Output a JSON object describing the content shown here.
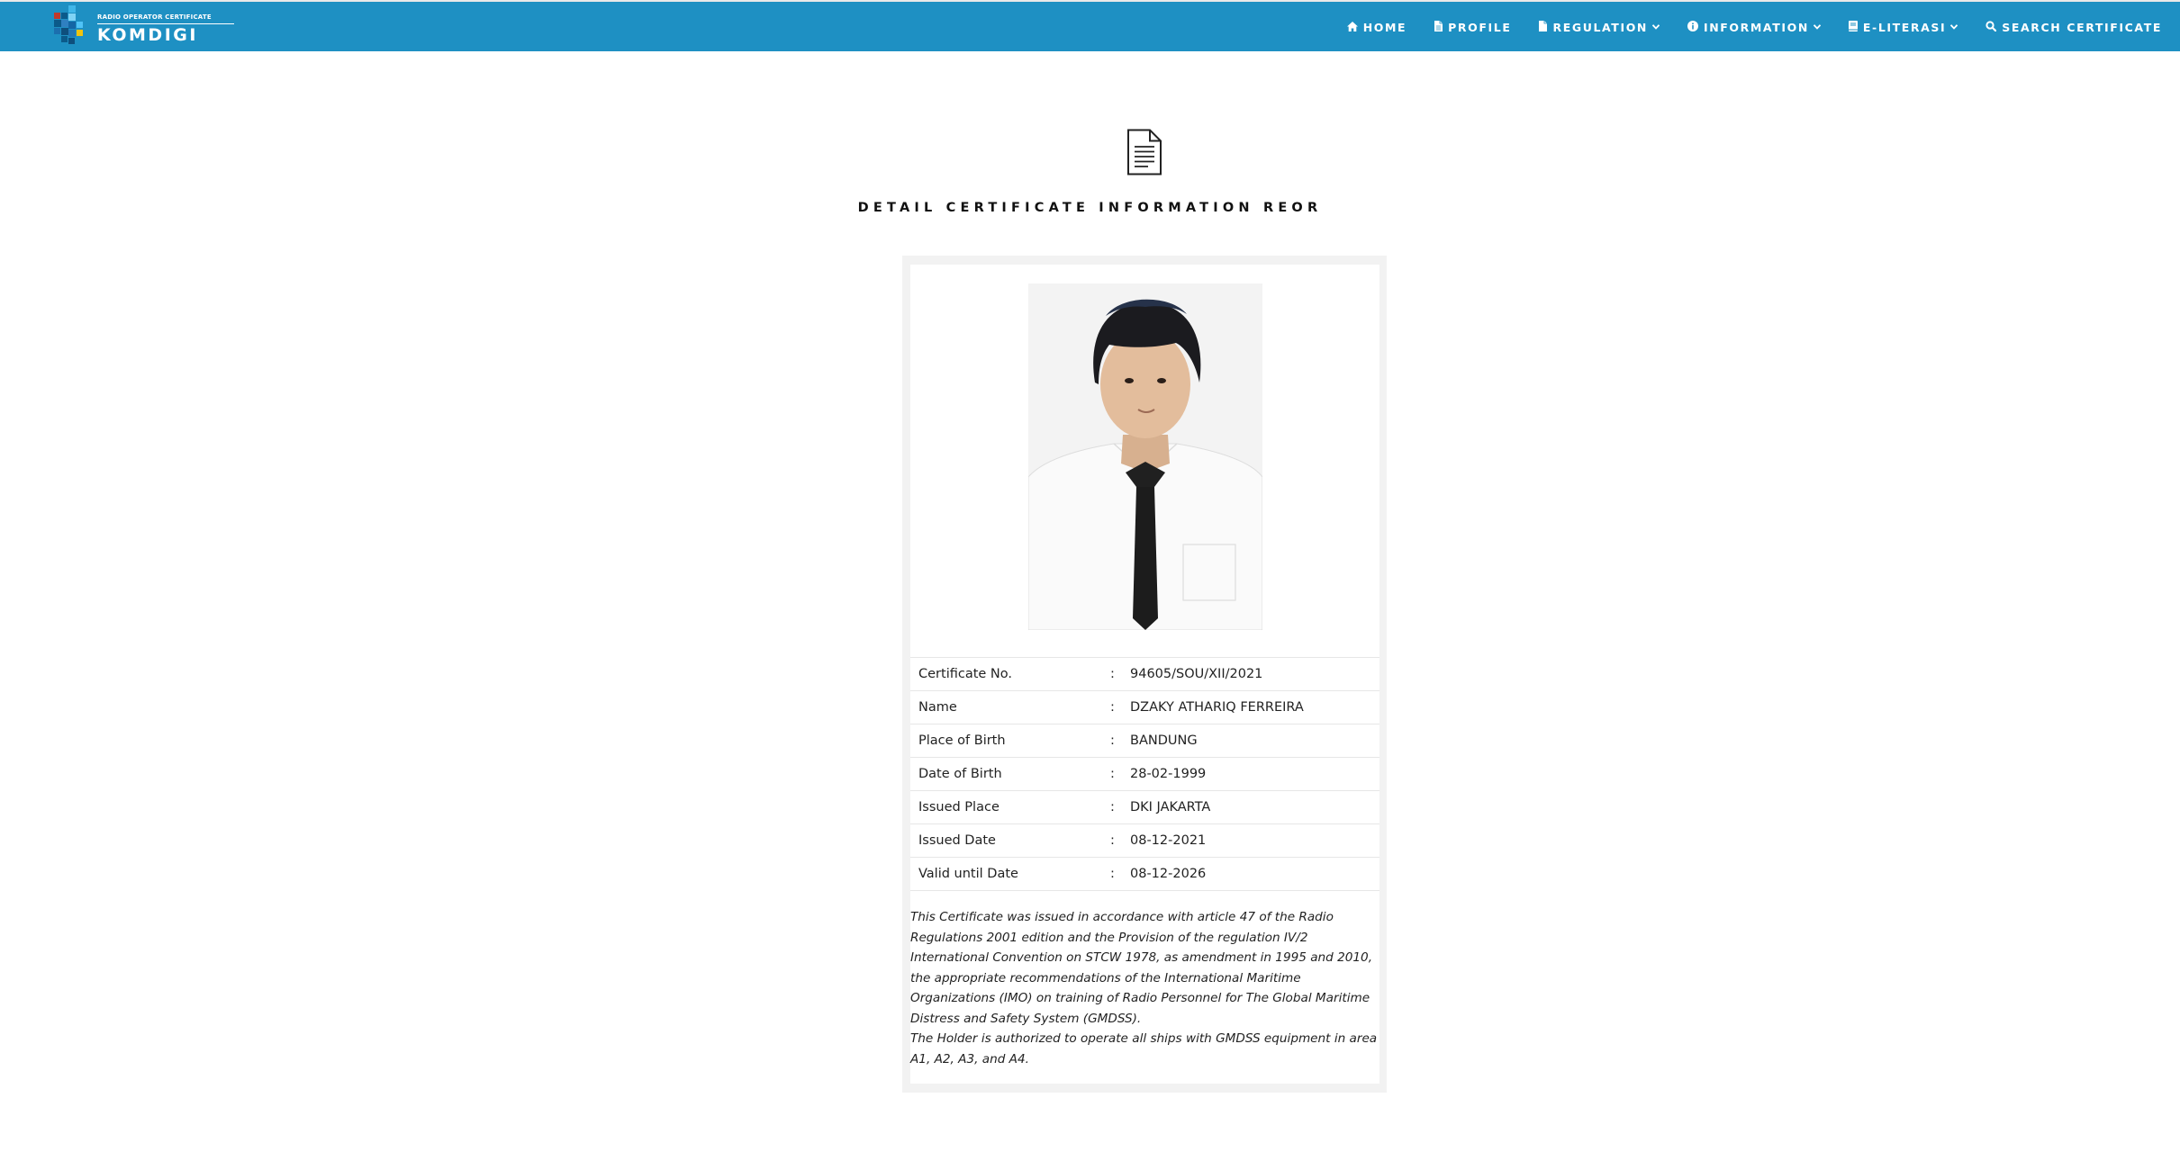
{
  "header": {
    "logo_small_text": "RADIO OPERATOR CERTIFICATE",
    "logo_text": "KOMDIGI",
    "brand_color": "#1e90c3",
    "nav": [
      {
        "label": "HOME",
        "icon": "home-icon"
      },
      {
        "label": "PROFILE",
        "icon": "document-icon"
      },
      {
        "label": "REGULATION",
        "icon": "document-icon",
        "dropdown": true
      },
      {
        "label": "INFORMATION",
        "icon": "info-circle-icon",
        "dropdown": true
      },
      {
        "label": "E-LITERASI",
        "icon": "book-icon",
        "dropdown": true
      },
      {
        "label": "SEARCH CERTIFICATE",
        "icon": "search-icon"
      }
    ]
  },
  "main": {
    "title": "DETAIL CERTIFICATE INFORMATION REOR",
    "photo_icon": "person-photo",
    "details": [
      {
        "label": "Certificate No.",
        "value": "94605/SOU/XII/2021"
      },
      {
        "label": "Name",
        "value": "DZAKY ATHARIQ FERREIRA"
      },
      {
        "label": "Place of Birth",
        "value": "BANDUNG"
      },
      {
        "label": "Date of Birth",
        "value": "28-02-1999"
      },
      {
        "label": "Issued Place",
        "value": "DKI JAKARTA"
      },
      {
        "label": "Issued Date",
        "value": "08-12-2021"
      },
      {
        "label": "Valid until Date",
        "value": "08-12-2026"
      }
    ],
    "separator": ":",
    "note_1": "This Certificate was issued in accordance with article 47 of the Radio Regulations 2001 edition and the Provision of the regulation IV/2 International Convention on STCW 1978, as amendment in 1995 and 2010, the appropriate recommendations of the International Maritime Organizations (IMO) on training of Radio Personnel for The Global Maritime Distress and Safety System (GMDSS).",
    "note_2": "The Holder is authorized to operate all ships with GMDSS equipment in area A1, A2, A3, and A4."
  }
}
